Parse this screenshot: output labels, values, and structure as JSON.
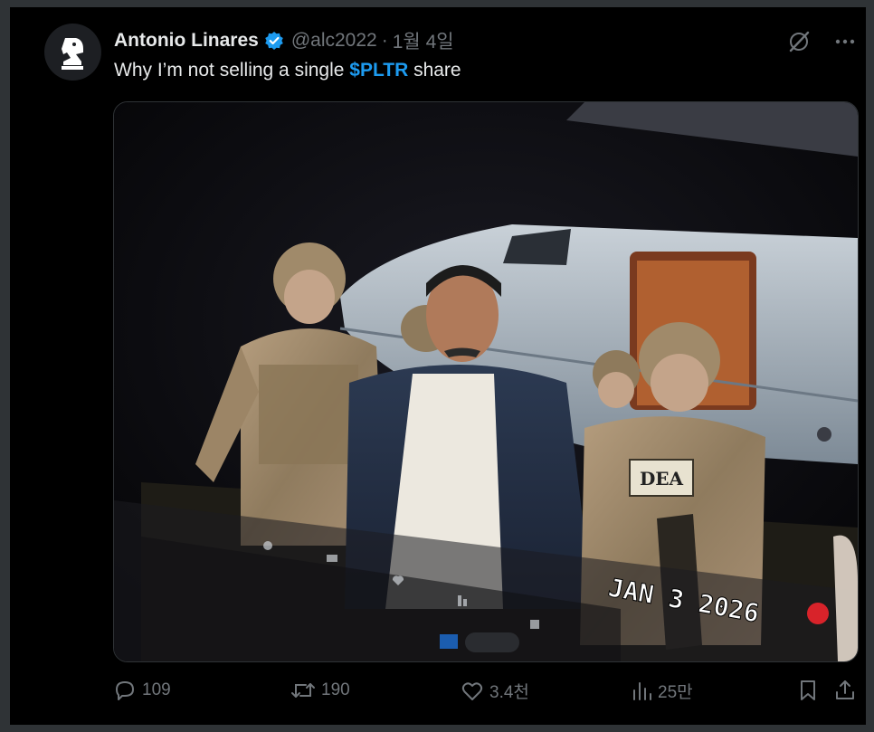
{
  "author": {
    "name": "Antonio Linares",
    "handle": "@alc2022",
    "separator": "·",
    "date": "1월 4일",
    "verified": true
  },
  "tweet": {
    "text_before": "Why I’m not selling a single ",
    "cashtag": "$PLTR",
    "text_after": " share"
  },
  "media": {
    "date_stamp": "JAN 3 2026",
    "patch_text": "DEA"
  },
  "actions": {
    "replies": "109",
    "reposts": "190",
    "likes": "3.4천",
    "views": "25만"
  },
  "icons": {
    "avatar": "chess-knight-logo",
    "verified": "verified-badge-icon",
    "grok": "grok-icon",
    "more": "more-icon",
    "reply": "reply-icon",
    "repost": "repost-icon",
    "like": "heart-icon",
    "views": "views-icon",
    "bookmark": "bookmark-icon",
    "share": "share-icon"
  },
  "colors": {
    "background": "#000000",
    "text": "#e7e9ea",
    "secondary": "#71767b",
    "accent": "#1d9bf0"
  }
}
